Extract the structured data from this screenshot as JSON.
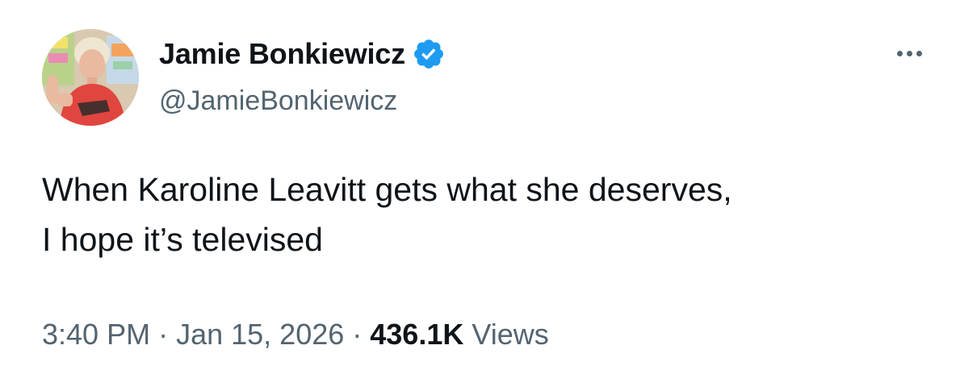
{
  "author": {
    "display_name": "Jamie Bonkiewicz",
    "handle": "@JamieBonkiewicz",
    "verified": true,
    "verified_color": "#1d9bf0",
    "avatar_icon": "profile-photo"
  },
  "tweet": {
    "lines": [
      "When Karoline Leavitt gets what she deserves,",
      "I hope it’s televised"
    ],
    "time": "3:40 PM",
    "date": "Jan 15, 2026",
    "separator": "·",
    "views_count": "436.1K",
    "views_label": "Views"
  },
  "menu": {
    "more_icon": "more-options-icon"
  },
  "colors": {
    "primary_text": "#0f1419",
    "secondary_text": "#536471",
    "background": "#ffffff"
  }
}
